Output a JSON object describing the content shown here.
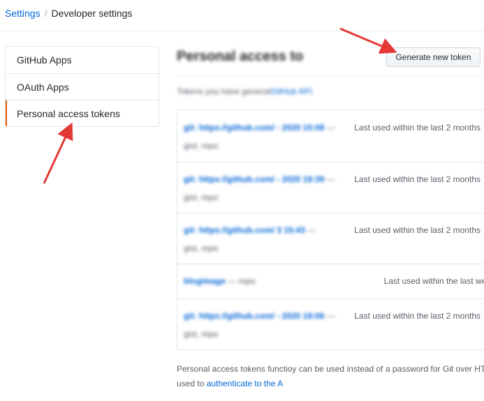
{
  "breadcrumb": {
    "parent": "Settings",
    "separator": "/",
    "current": "Developer settings"
  },
  "sidebar": {
    "items": [
      {
        "label": "GitHub Apps"
      },
      {
        "label": "OAuth Apps"
      },
      {
        "label": "Personal access tokens"
      }
    ]
  },
  "main": {
    "title": "Personal access to",
    "generate_button": "Generate new token",
    "subtitle_prefix": "Tokens you have generat",
    "subtitle_link": "GitHub API.",
    "tokens": [
      {
        "name": "git:",
        "url": "https://github.com/ - 2020 15:08",
        "dash": "—",
        "scopes": "gist, repo",
        "last_used": "Last used within the last 2 months"
      },
      {
        "name": "git:",
        "url": "https://github.com/ - 2020 18:39",
        "dash": "—",
        "scopes": "gist, repo",
        "last_used": "Last used within the last 2 months"
      },
      {
        "name": "git:",
        "url": "https://github.com/ 3 15:43",
        "dash": "—",
        "scopes": "gist, repo",
        "last_used": "Last used within the last 2 months"
      },
      {
        "name": "blogimage",
        "url": "",
        "dash": "—",
        "scopes": "repo",
        "last_used": "Last used within the last week"
      },
      {
        "name": "git:",
        "url": "https://github.com/ - 2020 18:06",
        "dash": "—",
        "scopes": "gist, repo",
        "last_used": "Last used within the last 2 months"
      }
    ],
    "footer_line1": "Personal access tokens functioy can be used instead of a password for Git over HTT",
    "footer_line2_prefix": "used to ",
    "footer_link": "authenticate to the A"
  },
  "colors": {
    "link": "#0366d6",
    "arrow": "#e53935",
    "selected_marker": "#e36209"
  }
}
